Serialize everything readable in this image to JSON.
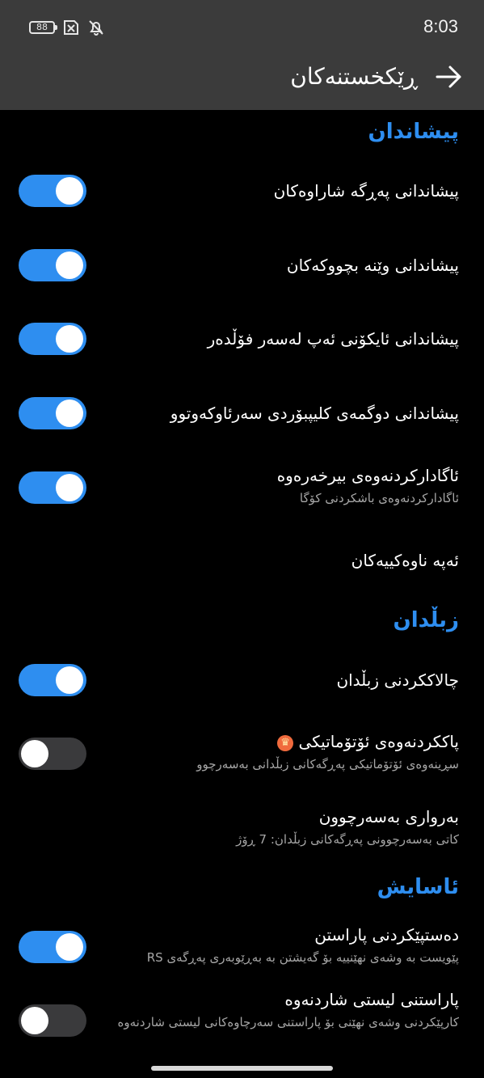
{
  "colors": {
    "accent": "#2e8ef0",
    "header_bg": "#3b3b3b",
    "background": "#000000",
    "toggle_off": "#3a3a3c",
    "subtitle": "#a6a6a6"
  },
  "status_bar": {
    "battery_level": "88",
    "time": "8:03",
    "icons": [
      "battery-icon",
      "sim-error-icon",
      "bell-muted-icon"
    ]
  },
  "header": {
    "title": "ڕێکخستنەکان",
    "back_icon": "arrow-right-icon"
  },
  "sections": {
    "preview": {
      "title": "پیشاندان",
      "items": [
        {
          "title": "پیشاندانی پەڕگە شاراوەکان",
          "toggle": true
        },
        {
          "title": "پیشاندانی وێنە بچووکەکان",
          "toggle": true
        },
        {
          "title": "پیشاندانی ئایکۆنی ئەپ لەسەر فۆڵدەر",
          "toggle": true
        },
        {
          "title": "پیشاندانی دوگمەی کلیپبۆردی سەرئاوکەوتوو",
          "toggle": true
        },
        {
          "title": "ئاگادارکردنەوەی بیرخەرەوە",
          "subtitle": "ئاگادارکردنەوەی باشکردنی کۆگا",
          "toggle": true
        },
        {
          "title": "ئەپە ناوەکییەکان"
        }
      ]
    },
    "trash": {
      "title": "زبڵدان",
      "items": [
        {
          "title": "چالاککردنی زبڵدان",
          "toggle": true
        },
        {
          "title": "پاککردنەوەی ئۆتۆماتیکی",
          "subtitle": "سڕینەوەی ئۆتۆماتیکی پەڕگەکانی زبڵدانی بەسەرچوو",
          "toggle": false,
          "badge_icon": "crown-icon"
        },
        {
          "title": "بەرواری بەسەرچوون",
          "subtitle": "کاتی بەسەرچوونی پەڕگەکانی زبڵدان: 7 ڕۆژ"
        }
      ]
    },
    "comfort": {
      "title": "ئاسایش",
      "items": [
        {
          "title": "دەستپێکردنی پاراستن",
          "subtitle": "پێویست بە وشەی نهێنییە بۆ گەیشتن بە بەڕێوبەری پەڕگەی RS",
          "toggle": true
        },
        {
          "title": "پاراستنی لیستی شاردنەوە",
          "subtitle": "کارپێکردنی وشەی نهێنی بۆ پاراستنی سەرچاوەکانی لیستی شاردنەوە",
          "toggle": false
        }
      ]
    }
  }
}
